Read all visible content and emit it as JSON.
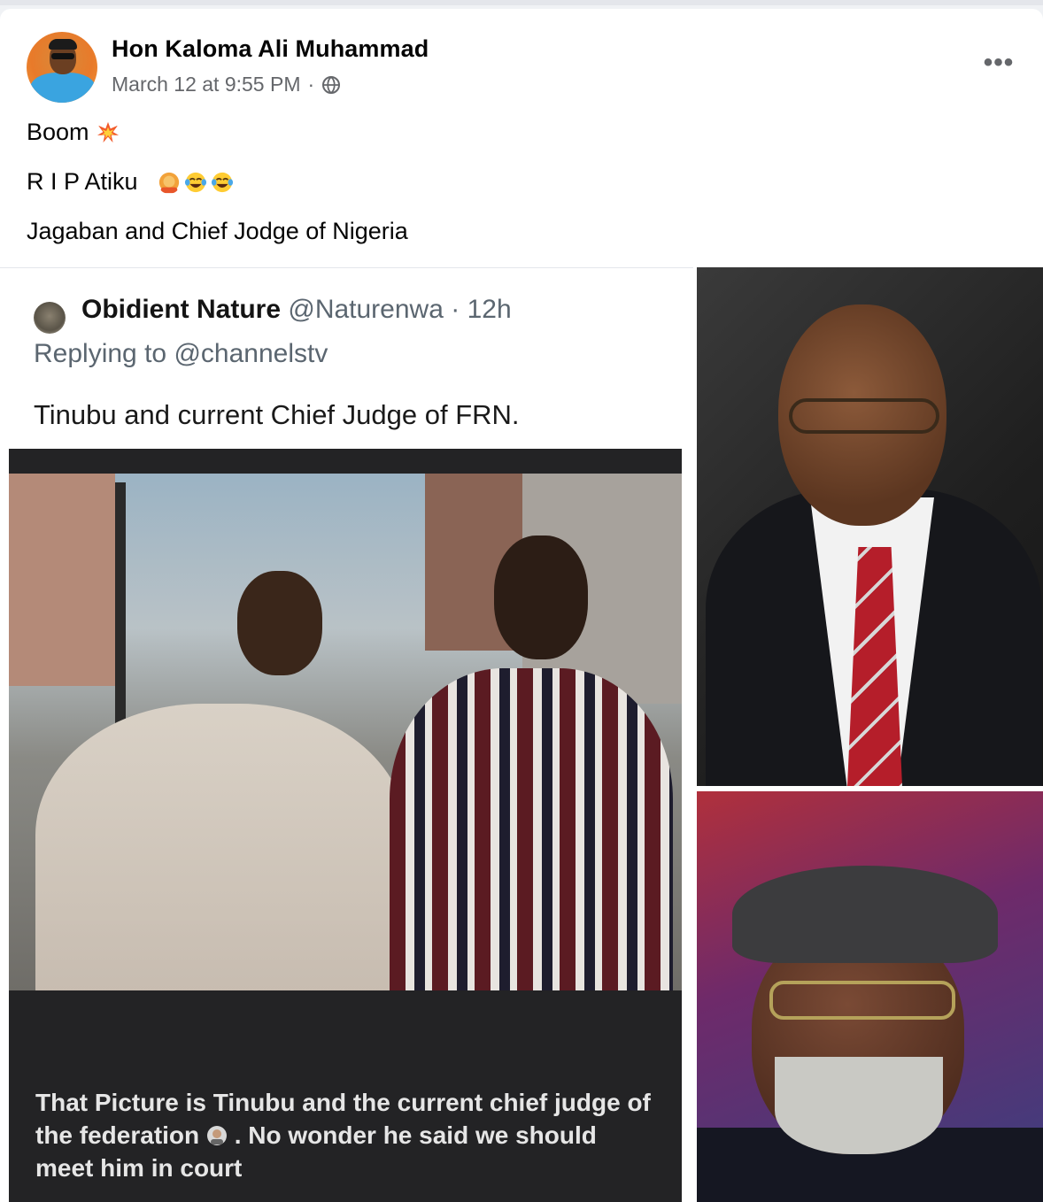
{
  "post": {
    "author": "Hon Kaloma Ali Muhammad",
    "timestamp": "March 12 at 9:55 PM",
    "separator": "·",
    "privacy_icon": "globe-icon",
    "more_icon": "more-options-icon",
    "lines": {
      "line1": "Boom",
      "line2": "R I P Atiku",
      "line3": "Jagaban and Chief Jodge of Nigeria"
    }
  },
  "tweet": {
    "name": "Obidient Nature",
    "handle": "@Naturenwa",
    "sep": "·",
    "age": "12h",
    "reply_prefix": "Replying to",
    "reply_to": "@channelstv",
    "body": "Tinubu and current Chief Judge of FRN.",
    "caption_part1": "That Picture is Tinubu and the current chief judge of the federation",
    "caption_part2": ". No wonder he said we should meet him in court"
  },
  "colors": {
    "secondary_text": "#65676b",
    "card_bg": "#ffffff",
    "page_bg": "#f0f2f5"
  }
}
